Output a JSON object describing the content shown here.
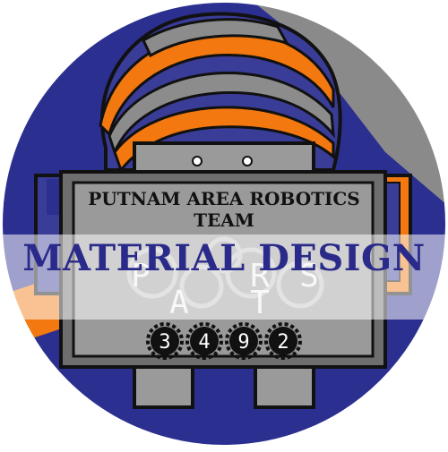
{
  "logo": {
    "team_name_line1": "PUTNAM AREA ROBOTICS",
    "team_name_line2": "TEAM",
    "banner_text": "MATERIAL DESIGN",
    "acronym_letters": [
      "P",
      "A",
      "R",
      "T",
      "S"
    ],
    "team_number_digits": [
      "3",
      "4",
      "9",
      "2"
    ]
  },
  "colors": {
    "background_blue": "#2b2f8f",
    "hat_orange": "#f2780f",
    "hat_blue": "#3a3d98",
    "hat_gray": "#8c8c8c",
    "robot_gray": "#9a9a9a",
    "robot_dark_gray": "#6e6e6e",
    "outline": "#111111",
    "banner_text": "#2a2a8a",
    "banner_band": "#ffffff"
  }
}
